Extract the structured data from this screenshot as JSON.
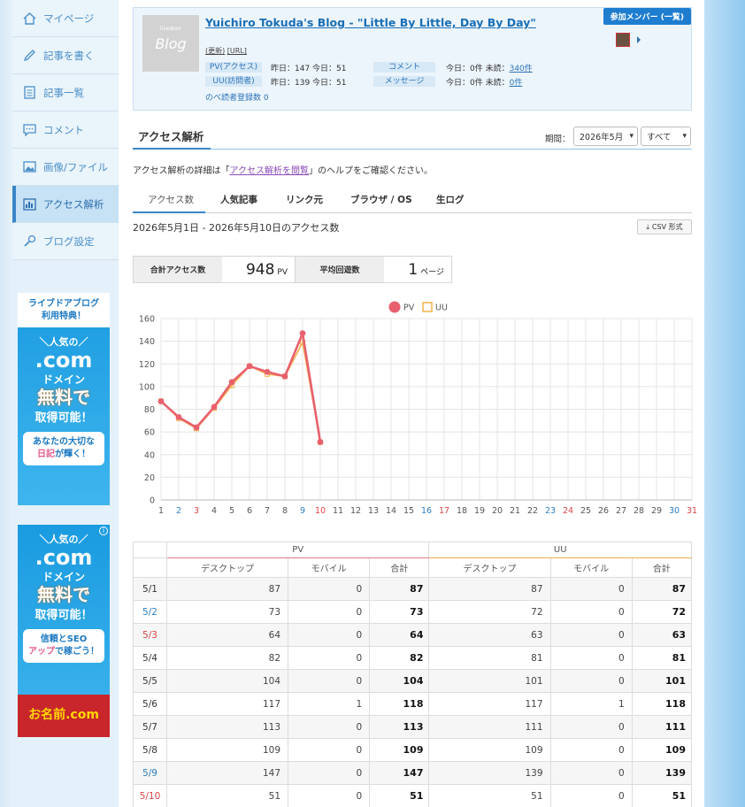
{
  "sidebar": {
    "items": [
      {
        "label": "マイページ",
        "icon": "home-icon"
      },
      {
        "label": "記事を書く",
        "icon": "pen-icon"
      },
      {
        "label": "記事一覧",
        "icon": "list-icon"
      },
      {
        "label": "コメント",
        "icon": "comment-icon"
      },
      {
        "label": "画像/ファイル",
        "icon": "image-icon"
      },
      {
        "label": "アクセス解析",
        "icon": "chart-icon",
        "active": true
      },
      {
        "label": "ブログ設定",
        "icon": "wrench-icon"
      }
    ]
  },
  "ads": {
    "ad1": {
      "top": "ライブドアブログ\n利用特典！",
      "ninki": "＼人気の／",
      "com": ".com",
      "domain": "ドメイン",
      "muryo": "無料で",
      "kanou": "取得可能！",
      "bubble": "あなたの大切な",
      "bubble_red": "日記",
      "bubble_tail": "が輝く！"
    },
    "ad2": {
      "ninki": "＼人気の／",
      "com": ".com",
      "domain": "ドメイン",
      "muryo": "無料で",
      "kanou": "取得可能！",
      "bubble": "信頼とSEO",
      "bubble_red": "アップ",
      "bubble_tail": "で稼ごう！",
      "brand": "お名前.com"
    }
  },
  "blog": {
    "title": "Yuichiro Tokuda's Blog - \"Little By Little, Day By Day\"",
    "sub_edit": "(更新)",
    "sub_url": "[URL]",
    "thumb_text": "Blog",
    "thumb_small": "livedoor",
    "pv_label": "PV(アクセス)",
    "pv_stats": "昨日：147  今日：51",
    "uu_label": "UU(訪問者)",
    "uu_stats": "昨日：139  今日：51",
    "comment_label": "コメント",
    "comment_stats": "今日：0件  未読：",
    "comment_unread": "340件",
    "message_label": "メッセージ",
    "message_stats": "今日：0件  未読：",
    "message_unread": "0件",
    "readers": "のべ読者登録数  0",
    "member_button": "参加メンバー (一覧)"
  },
  "analytics": {
    "title": "アクセス解析",
    "period_label": "期間：",
    "period_value": "2026年5月",
    "filter_value": "すべて",
    "help_prefix": "アクセス解析の詳細は「",
    "help_link": "アクセス解析を閲覧",
    "help_suffix": "」のヘルプをご確認ください。",
    "tabs": [
      "アクセス数",
      "人気記事",
      "リンク元",
      "ブラウザ / OS",
      "生ログ"
    ],
    "range": "2026年5月1日 - 2026年5月10日のアクセス数",
    "csv": "CSV 形式",
    "total_label": "合計アクセス数",
    "total_value": "948",
    "total_unit": "PV",
    "avg_label": "平均回遊数",
    "avg_value": "1",
    "avg_unit": "ページ"
  },
  "chart_data": {
    "type": "line",
    "x": [
      1,
      2,
      3,
      4,
      5,
      6,
      7,
      8,
      9,
      10,
      11,
      12,
      13,
      14,
      15,
      16,
      17,
      18,
      19,
      20,
      21,
      22,
      23,
      24,
      25,
      26,
      27,
      28,
      29,
      30,
      31
    ],
    "ylim": [
      0,
      160
    ],
    "yticks": [
      0,
      20,
      40,
      60,
      80,
      100,
      120,
      140,
      160
    ],
    "grid": true,
    "legend": "top-center",
    "blue_days": [
      2,
      9,
      16,
      23,
      30
    ],
    "red_days": [
      3,
      10,
      17,
      24,
      31
    ],
    "series": [
      {
        "name": "PV",
        "color": "#e8606e",
        "values": [
          87,
          73,
          64,
          82,
          104,
          118,
          113,
          109,
          147,
          51
        ]
      },
      {
        "name": "UU",
        "color": "#f2b04a",
        "values": [
          87,
          72,
          63,
          81,
          101,
          118,
          111,
          109,
          139,
          51
        ]
      }
    ]
  },
  "table": {
    "group_pv": "PV",
    "group_uu": "UU",
    "sub_headers": [
      "デスクトップ",
      "モバイル",
      "合計",
      "デスクトップ",
      "モバイル",
      "合計"
    ],
    "rows": [
      {
        "date": "5/1",
        "c": "",
        "v": [
          "87",
          "0",
          "87",
          "87",
          "0",
          "87"
        ]
      },
      {
        "date": "5/2",
        "c": "blue",
        "v": [
          "73",
          "0",
          "73",
          "72",
          "0",
          "72"
        ]
      },
      {
        "date": "5/3",
        "c": "red",
        "v": [
          "64",
          "0",
          "64",
          "63",
          "0",
          "63"
        ]
      },
      {
        "date": "5/4",
        "c": "",
        "v": [
          "82",
          "0",
          "82",
          "81",
          "0",
          "81"
        ]
      },
      {
        "date": "5/5",
        "c": "",
        "v": [
          "104",
          "0",
          "104",
          "101",
          "0",
          "101"
        ]
      },
      {
        "date": "5/6",
        "c": "",
        "v": [
          "117",
          "1",
          "118",
          "117",
          "1",
          "118"
        ]
      },
      {
        "date": "5/7",
        "c": "",
        "v": [
          "113",
          "0",
          "113",
          "111",
          "0",
          "111"
        ]
      },
      {
        "date": "5/8",
        "c": "",
        "v": [
          "109",
          "0",
          "109",
          "109",
          "0",
          "109"
        ]
      },
      {
        "date": "5/9",
        "c": "blue",
        "v": [
          "147",
          "0",
          "147",
          "139",
          "0",
          "139"
        ]
      },
      {
        "date": "5/10",
        "c": "red",
        "v": [
          "51",
          "0",
          "51",
          "51",
          "0",
          "51"
        ]
      }
    ]
  }
}
